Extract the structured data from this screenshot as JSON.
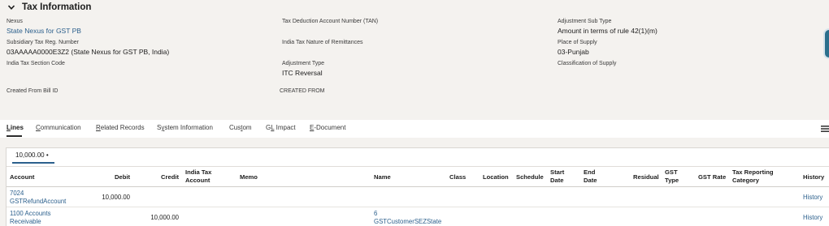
{
  "section": {
    "title": "Tax Information"
  },
  "fields": {
    "nexus": {
      "label": "Nexus",
      "value": "State Nexus for GST PB"
    },
    "subsidiary_tax_reg": {
      "label": "Subsidiary Tax Reg. Number",
      "value": "03AAAAA0000E3Z2 (State Nexus for GST PB, India)"
    },
    "india_tax_section_code": {
      "label": "India Tax Section Code",
      "value": ""
    },
    "created_from_bill_id": {
      "label": "Created From Bill ID",
      "value": ""
    },
    "tan": {
      "label": "Tax Deduction Account Number (TAN)",
      "value": ""
    },
    "nature_of_remittances": {
      "label": "India Tax Nature of Remittances",
      "value": ""
    },
    "adjustment_type": {
      "label": "Adjustment Type",
      "value": "ITC Reversal"
    },
    "created_from": {
      "label": "CREATED FROM",
      "value": ""
    },
    "adjustment_sub_type": {
      "label": "Adjustment Sub Type",
      "value": "Amount in terms of rule 42(1)(m)"
    },
    "place_of_supply": {
      "label": "Place of Supply",
      "value": "03-Punjab"
    },
    "classification_of_supply": {
      "label": "Classification of Supply",
      "value": ""
    }
  },
  "tabs": [
    {
      "pre": "",
      "ul": "L",
      "post": "ines"
    },
    {
      "pre": "",
      "ul": "C",
      "post": "ommunication"
    },
    {
      "pre": "",
      "ul": "R",
      "post": "elated Records"
    },
    {
      "pre": "S",
      "ul": "y",
      "post": "stem Information"
    },
    {
      "pre": "Cus",
      "ul": "t",
      "post": "om"
    },
    {
      "pre": "G",
      "ul": "L",
      "post": " Impact"
    },
    {
      "pre": "",
      "ul": "E",
      "post": "-Document"
    }
  ],
  "lines": {
    "subtab": "10,000.00 •",
    "headers": {
      "account": "Account",
      "debit": "Debit",
      "credit": "Credit",
      "india_tax_account": "India Tax Account",
      "memo": "Memo",
      "name": "Name",
      "class": "Class",
      "location": "Location",
      "schedule": "Schedule",
      "start_date": "Start Date",
      "end_date": "End Date",
      "residual": "Residual",
      "gst_type": "GST Type",
      "gst_rate": "GST Rate",
      "tax_reporting_category": "Tax Reporting Category",
      "history": "History"
    },
    "rows": [
      {
        "account": "7024 GSTRefundAccount",
        "debit": "10,000.00",
        "credit": "",
        "name": "",
        "history": "History"
      },
      {
        "account": "1100 Accounts Receivable",
        "debit": "",
        "credit": "10,000.00",
        "name": "6 GSTCustomerSEZState",
        "history": "History"
      }
    ]
  }
}
